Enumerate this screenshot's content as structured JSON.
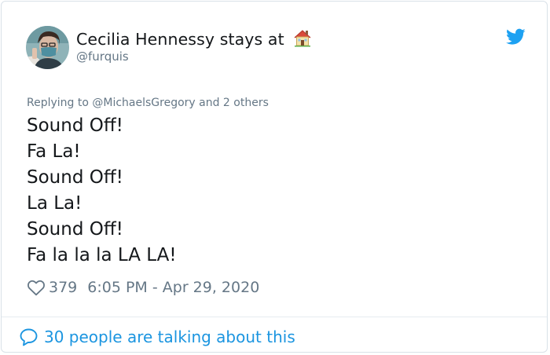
{
  "tweet": {
    "author": {
      "display_name": "Cecilia Hennessy stays at",
      "name_emoji": "house-icon",
      "handle": "@furquis",
      "avatar": "avatar-photo"
    },
    "platform_icon": "twitter-bird-icon",
    "reply_context": "Replying to @MichaelsGregory and 2 others",
    "body_lines": [
      "Sound Off!",
      "Fa La!",
      "Sound Off!",
      "La La!",
      "Sound Off!",
      "Fa la la la LA LA!"
    ],
    "likes": "379",
    "timestamp": "6:05 PM - Apr 29, 2020",
    "conversation_link": "30 people are talking about this"
  },
  "colors": {
    "brand_blue": "#1da1f2",
    "link_blue": "#1b95e0",
    "primary_text": "#14171a",
    "secondary_text": "#657786",
    "border": "#d9e1e8"
  }
}
